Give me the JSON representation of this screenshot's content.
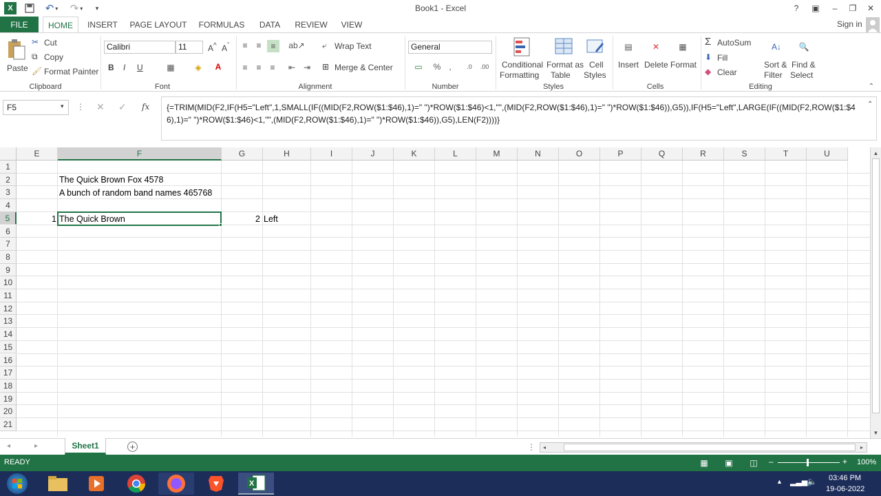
{
  "window": {
    "title": "Book1 - Excel"
  },
  "qat": {
    "save_tooltip": "",
    "undo": "↶",
    "redo": "↷"
  },
  "window_controls": {
    "help": "?",
    "ribbon_display": "▣",
    "minimize": "–",
    "restore": "❐",
    "close": "✕",
    "sign_in": "Sign in"
  },
  "tabs": [
    "FILE",
    "HOME",
    "INSERT",
    "PAGE LAYOUT",
    "FORMULAS",
    "DATA",
    "REVIEW",
    "VIEW"
  ],
  "ribbon": {
    "clipboard": {
      "paste": "Paste",
      "cut": "Cut",
      "copy": "Copy",
      "format_painter": "Format Painter",
      "label": "Clipboard"
    },
    "font": {
      "name": "Calibri",
      "size": "11",
      "bold": "B",
      "italic": "I",
      "underline": "U",
      "label": "Font"
    },
    "alignment": {
      "wrap": "Wrap Text",
      "merge": "Merge & Center",
      "label": "Alignment"
    },
    "number": {
      "format": "General",
      "label": "Number"
    },
    "styles": {
      "conditional_1": "Conditional",
      "conditional_2": "Formatting",
      "format_as_1": "Format as",
      "format_as_2": "Table",
      "cell_styles_1": "Cell",
      "cell_styles_2": "Styles",
      "label": "Styles"
    },
    "cells": {
      "insert": "Insert",
      "delete": "Delete",
      "format": "Format",
      "label": "Cells"
    },
    "editing": {
      "autosum": "AutoSum",
      "fill": "Fill",
      "clear": "Clear",
      "sort_1": "Sort &",
      "sort_2": "Filter",
      "find_1": "Find &",
      "find_2": "Select",
      "label": "Editing"
    }
  },
  "formula_bar": {
    "name_box": "F5",
    "fx": "fx",
    "formula": "{=TRIM(MID(F2,IF(H5=\"Left\",1,SMALL(IF((MID(F2,ROW($1:$46),1)=\" \")*ROW($1:$46)<1,\"\",(MID(F2,ROW($1:$46),1)=\" \")*ROW($1:$46)),G5)),IF(H5=\"Left\",LARGE(IF((MID(F2,ROW($1:$46),1)=\" \")*ROW($1:$46)<1,\"\",(MID(F2,ROW($1:$46),1)=\" \")*ROW($1:$46)),G5),LEN(F2))))}"
  },
  "columns": [
    "E",
    "F",
    "G",
    "H",
    "I",
    "J",
    "K",
    "L",
    "M",
    "N",
    "O",
    "P",
    "Q",
    "R",
    "S",
    "T",
    "U"
  ],
  "rows": [
    "1",
    "2",
    "3",
    "4",
    "5",
    "6",
    "7",
    "8",
    "9",
    "10",
    "11",
    "12",
    "13",
    "14",
    "15",
    "16",
    "17",
    "18",
    "19",
    "20",
    "21"
  ],
  "cells": {
    "F2": "The Quick Brown Fox 4578",
    "F3": "A bunch of random band names 465768",
    "E5": "1",
    "F5": "The Quick Brown",
    "G5": "2",
    "H5": "Left"
  },
  "sheet": {
    "active_tab": "Sheet1",
    "add_sheet": "+"
  },
  "status": {
    "mode": "READY",
    "zoom": "100%"
  },
  "taskbar": {
    "time": "03:46 PM",
    "date": "19-06-2022"
  },
  "colors": {
    "excel_green": "#217346",
    "taskbar": "#1c2d5a"
  }
}
